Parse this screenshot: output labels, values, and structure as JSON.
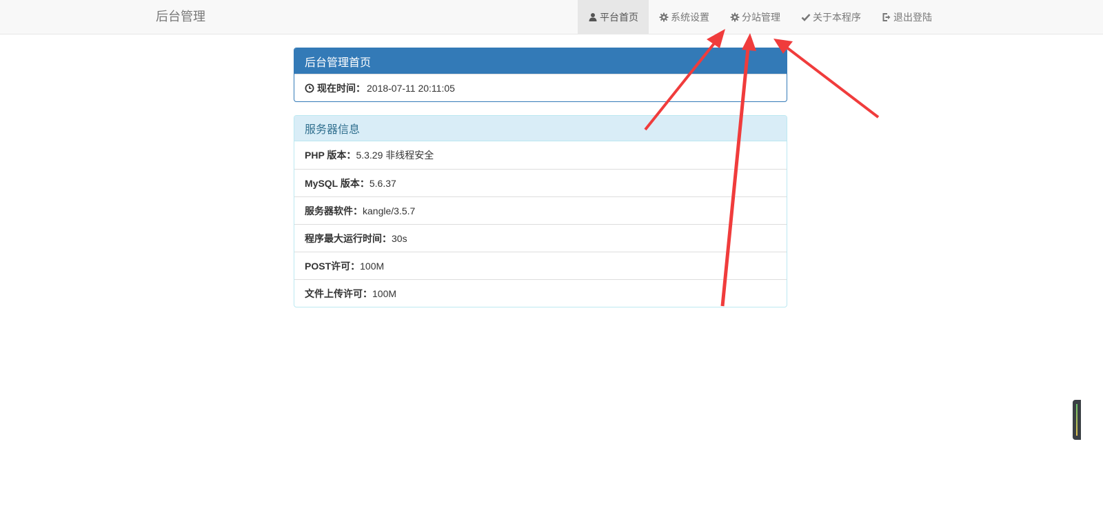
{
  "brand": "后台管理",
  "nav": {
    "items": [
      {
        "label": "平台首页",
        "icon": "user-icon",
        "active": true
      },
      {
        "label": "系统设置",
        "icon": "gear-icon"
      },
      {
        "label": "分站管理",
        "icon": "gear-icon"
      },
      {
        "label": "关于本程序",
        "icon": "check-icon"
      },
      {
        "label": "退出登陆",
        "icon": "logout-icon"
      }
    ]
  },
  "home_panel": {
    "title": "后台管理首页",
    "time_label": "现在时间：",
    "time_value": "2018-07-11 20:11:05"
  },
  "server_panel": {
    "title": "服务器信息",
    "rows": [
      {
        "label": "PHP 版本：",
        "value": "5.3.29 非线程安全"
      },
      {
        "label": "MySQL 版本：",
        "value": "5.6.37"
      },
      {
        "label": "服务器软件：",
        "value": "kangle/3.5.7"
      },
      {
        "label": "程序最大运行时间：",
        "value": "30s"
      },
      {
        "label": "POST许可：",
        "value": "100M"
      },
      {
        "label": "文件上传许可：",
        "value": "100M"
      }
    ]
  },
  "colors": {
    "primary": "#337ab7",
    "info_bg": "#d9edf7",
    "info_text": "#31708f",
    "annotation_arrow": "#f03c3c"
  }
}
